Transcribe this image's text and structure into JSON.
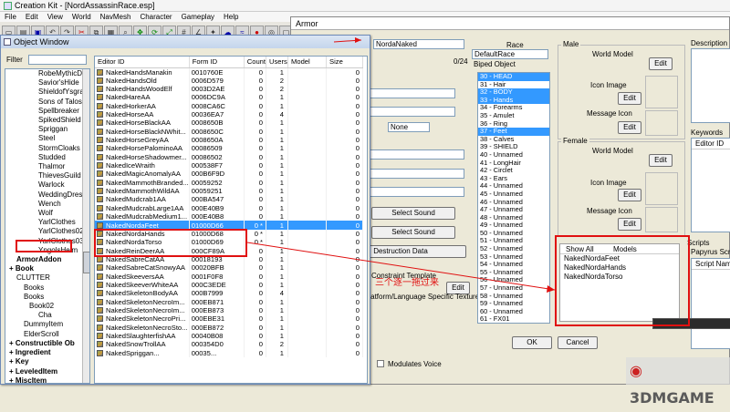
{
  "app": {
    "title": "Creation Kit - [NordAssassinRace.esp]",
    "menu": [
      "File",
      "Edit",
      "View",
      "World",
      "NavMesh",
      "Character",
      "Gameplay",
      "Help"
    ],
    "toolbar_icons": [
      "new-icon",
      "open-icon",
      "save-icon",
      "undo-icon",
      "redo-icon",
      "cut-icon",
      "copy-icon",
      "paste-icon",
      "zoom-icon",
      "move-icon",
      "rotate-icon",
      "scale-icon",
      "snap-grid-icon",
      "snap-angle-icon",
      "light-icon",
      "sky-icon",
      "water-icon",
      "havok-icon",
      "camera-icon",
      "cell-icon",
      "marker-icon",
      "navmesh-icon",
      "render-icon",
      "wire-icon",
      "terrain-icon",
      "tree-icon",
      "grass-icon",
      "sound-icon",
      "script-icon",
      "quest-icon",
      "dialog-icon",
      "npc-icon",
      "package-icon",
      "combat-icon",
      "faction-icon",
      "race-icon",
      "class-icon",
      "spell-icon",
      "leveled-icon",
      "export-icon",
      "help-icon"
    ]
  },
  "armor": {
    "title": "Armor",
    "editor_id_value": "NordaNaked",
    "counter": "0/24",
    "race_label": "Race",
    "race_value": "DefaultRace",
    "biped_label": "Biped Object",
    "biped_items": [
      {
        "text": "30 - HEAD",
        "selected": true
      },
      {
        "text": "31 - Hair",
        "selected": false
      },
      {
        "text": "32 - BODY",
        "selected": true
      },
      {
        "text": "33 - Hands",
        "selected": true
      },
      {
        "text": "34 - Forearms",
        "selected": false
      },
      {
        "text": "35 - Amulet",
        "selected": false
      },
      {
        "text": "36 - Ring",
        "selected": false
      },
      {
        "text": "37 - Feet",
        "selected": true
      },
      {
        "text": "38 - Calves",
        "selected": false
      },
      {
        "text": "39 - SHIELD",
        "selected": false
      },
      {
        "text": "40 - Unnamed",
        "selected": false
      },
      {
        "text": "41 - LongHair",
        "selected": false
      },
      {
        "text": "42 - Circlet",
        "selected": false
      },
      {
        "text": "43 - Ears",
        "selected": false
      },
      {
        "text": "44 - Unnamed",
        "selected": false
      },
      {
        "text": "45 - Unnamed",
        "selected": false
      },
      {
        "text": "46 - Unnamed",
        "selected": false
      },
      {
        "text": "47 - Unnamed",
        "selected": false
      },
      {
        "text": "48 - Unnamed",
        "selected": false
      },
      {
        "text": "49 - Unnamed",
        "selected": false
      },
      {
        "text": "50 - Unnamed",
        "selected": false
      },
      {
        "text": "51 - Unnamed",
        "selected": false
      },
      {
        "text": "52 - Unnamed",
        "selected": false
      },
      {
        "text": "53 - Unnamed",
        "selected": false
      },
      {
        "text": "54 - Unnamed",
        "selected": false
      },
      {
        "text": "55 - Unnamed",
        "selected": false
      },
      {
        "text": "56 - Unnamed",
        "selected": false
      },
      {
        "text": "57 - Unnamed",
        "selected": false
      },
      {
        "text": "58 - Unnamed",
        "selected": false
      },
      {
        "text": "59 - Unnamed",
        "selected": false
      },
      {
        "text": "60 - Unnamed",
        "selected": false
      },
      {
        "text": "61 - FX01",
        "selected": false
      }
    ],
    "none_option": "None",
    "select_sound_1": "Select Sound",
    "select_sound_2": "Select Sound",
    "destruction_data": "Destruction Data",
    "constraint_template": "Constraint Template",
    "edit": "Edit",
    "platform_textures": "Platform/Language Specific Textures",
    "modulates_voice": "Modulates Voice",
    "male_label": "Male",
    "female_label": "Female",
    "world_model": "World Model",
    "icon_image": "Icon Image",
    "message_icon": "Message Icon",
    "show_all": "Show All",
    "models_header": "Models",
    "models": [
      "NakedNordaFeet",
      "NakedNordaHands",
      "NakedNordaTorso"
    ],
    "ok": "OK",
    "cancel": "Cancel",
    "description_label": "Description",
    "keywords_label": "Keywords",
    "keywords_col": "Editor ID",
    "scripts_label": "Scripts",
    "papyrus_label": "Papyrus Scripts:",
    "script_name_col": "Script Nam",
    "annotation": "三个逐一拖过来"
  },
  "object_window": {
    "title": "Object Window",
    "filter_label": "Filter",
    "filter_value": "",
    "tree": [
      {
        "text": "RobeMythicDa",
        "level": 4,
        "bold": false
      },
      {
        "text": "Savior'sHide",
        "level": 4,
        "bold": false
      },
      {
        "text": "ShieldofYsgramo",
        "level": 4,
        "bold": false
      },
      {
        "text": "Sons of Talos",
        "level": 4,
        "bold": false
      },
      {
        "text": "Spellbreaker",
        "level": 4,
        "bold": false
      },
      {
        "text": "SpikedShield",
        "level": 4,
        "bold": false
      },
      {
        "text": "Spriggan",
        "level": 4,
        "bold": false
      },
      {
        "text": "Steel",
        "level": 4,
        "bold": false
      },
      {
        "text": "StormCloaks",
        "level": 4,
        "bold": false
      },
      {
        "text": "Studded",
        "level": 4,
        "bold": false
      },
      {
        "text": "Thalmor",
        "level": 4,
        "bold": false
      },
      {
        "text": "ThievesGuild",
        "level": 4,
        "bold": false
      },
      {
        "text": "Warlock",
        "level": 4,
        "bold": false
      },
      {
        "text": "WeddingDress",
        "level": 4,
        "bold": false
      },
      {
        "text": "Wench",
        "level": 4,
        "bold": false
      },
      {
        "text": "Wolf",
        "level": 4,
        "bold": false
      },
      {
        "text": "YarlClothes",
        "level": 4,
        "bold": false
      },
      {
        "text": "YarlClothes02",
        "level": 4,
        "bold": false
      },
      {
        "text": "YarlClothes03",
        "level": 4,
        "bold": false
      },
      {
        "text": "YngolsHelm",
        "level": 4,
        "bold": false
      },
      {
        "text": "ArmorAddon",
        "level": 1,
        "bold": true
      },
      {
        "text": "Book",
        "level": 0,
        "bold": true
      },
      {
        "text": "CLUTTER",
        "level": 1,
        "bold": false
      },
      {
        "text": "Books",
        "level": 2,
        "bold": false
      },
      {
        "text": "Books",
        "level": 2,
        "bold": false
      },
      {
        "text": "Book02",
        "level": 3,
        "bold": false
      },
      {
        "text": "Cha",
        "level": 4,
        "bold": false
      },
      {
        "text": "DummyItem",
        "level": 2,
        "bold": false
      },
      {
        "text": "ElderScroll",
        "level": 2,
        "bold": false
      },
      {
        "text": "Constructible Ob",
        "level": 0,
        "bold": true
      },
      {
        "text": "Ingredient",
        "level": 0,
        "bold": true
      },
      {
        "text": "Key",
        "level": 0,
        "bold": true
      },
      {
        "text": "LeveledItem",
        "level": 0,
        "bold": true
      },
      {
        "text": "MiscItem",
        "level": 0,
        "bold": true
      }
    ],
    "columns": [
      "Editor ID",
      "Form ID",
      "Count",
      "Users",
      "Model",
      "Size"
    ],
    "rows": [
      {
        "id": "NakedHandsManakin",
        "form": "0010760E",
        "count": "0",
        "users": "1",
        "model": "",
        "size": "0",
        "sel": false
      },
      {
        "id": "NakedHandsOld",
        "form": "0006D579",
        "count": "0",
        "users": "2",
        "model": "",
        "size": "0",
        "sel": false
      },
      {
        "id": "NakedHandsWoodElf",
        "form": "0003D2AE",
        "count": "0",
        "users": "2",
        "model": "",
        "size": "0",
        "sel": false
      },
      {
        "id": "NakedHareAA",
        "form": "0006DC9A",
        "count": "0",
        "users": "1",
        "model": "",
        "size": "0",
        "sel": false
      },
      {
        "id": "NakedHorkerAA",
        "form": "0008CA6C",
        "count": "0",
        "users": "1",
        "model": "",
        "size": "0",
        "sel": false
      },
      {
        "id": "NakedHorseAA",
        "form": "00036EA7",
        "count": "0",
        "users": "4",
        "model": "",
        "size": "0",
        "sel": false
      },
      {
        "id": "NakedHorseBlackAA",
        "form": "0008650B",
        "count": "0",
        "users": "1",
        "model": "",
        "size": "0",
        "sel": false
      },
      {
        "id": "NakedHorseBlackNWhit...",
        "form": "0008650C",
        "count": "0",
        "users": "1",
        "model": "",
        "size": "0",
        "sel": false
      },
      {
        "id": "NakedHorseGreyAA",
        "form": "0008650A",
        "count": "0",
        "users": "1",
        "model": "",
        "size": "0",
        "sel": false
      },
      {
        "id": "NakedHorsePalominoAA",
        "form": "00086509",
        "count": "0",
        "users": "1",
        "model": "",
        "size": "0",
        "sel": false
      },
      {
        "id": "NakedHorseShadowmer...",
        "form": "00086502",
        "count": "0",
        "users": "1",
        "model": "",
        "size": "0",
        "sel": false
      },
      {
        "id": "NakedIceWraith",
        "form": "000538F7",
        "count": "0",
        "users": "1",
        "model": "",
        "size": "0",
        "sel": false
      },
      {
        "id": "NakedMagicAnomalyAA",
        "form": "000B6F9D",
        "count": "0",
        "users": "1",
        "model": "",
        "size": "0",
        "sel": false
      },
      {
        "id": "NakedMammothBranded...",
        "form": "00059252",
        "count": "0",
        "users": "1",
        "model": "",
        "size": "0",
        "sel": false
      },
      {
        "id": "NakedMammothWildAA",
        "form": "00059251",
        "count": "0",
        "users": "1",
        "model": "",
        "size": "0",
        "sel": false
      },
      {
        "id": "NakedMudcrab1AA",
        "form": "000BA547",
        "count": "0",
        "users": "1",
        "model": "",
        "size": "0",
        "sel": false
      },
      {
        "id": "NakedMudcrabLarge1AA",
        "form": "000E40B9",
        "count": "0",
        "users": "1",
        "model": "",
        "size": "0",
        "sel": false
      },
      {
        "id": "NakedMudcrabMedium1...",
        "form": "000E40B8",
        "count": "0",
        "users": "1",
        "model": "",
        "size": "0",
        "sel": false
      },
      {
        "id": "NakedNordaFeet",
        "form": "01000D66",
        "count": "0 *",
        "users": "1",
        "model": "",
        "size": "0",
        "sel": true
      },
      {
        "id": "NakedNordaHands",
        "form": "01000D68",
        "count": "0 *",
        "users": "1",
        "model": "",
        "size": "0",
        "sel": false
      },
      {
        "id": "NakedNordaTorso",
        "form": "01000D69",
        "count": "0 *",
        "users": "1",
        "model": "",
        "size": "0",
        "sel": false
      },
      {
        "id": "NakedReinDeerAA",
        "form": "000CF89A",
        "count": "0",
        "users": "1",
        "model": "",
        "size": "0",
        "sel": false
      },
      {
        "id": "NakedSabreCatAA",
        "form": "00018193",
        "count": "0",
        "users": "1",
        "model": "",
        "size": "0",
        "sel": false
      },
      {
        "id": "NakedSabreCatSnowyAA",
        "form": "00020BFB",
        "count": "0",
        "users": "1",
        "model": "",
        "size": "0",
        "sel": false
      },
      {
        "id": "NakedSkeeversAA",
        "form": "0001F0F8",
        "count": "0",
        "users": "1",
        "model": "",
        "size": "0",
        "sel": false
      },
      {
        "id": "NakedSkeeverWhiteAA",
        "form": "000C3EDE",
        "count": "0",
        "users": "1",
        "model": "",
        "size": "0",
        "sel": false
      },
      {
        "id": "NakedSkeletonBodyAA",
        "form": "000B7999",
        "count": "0",
        "users": "4",
        "model": "",
        "size": "0",
        "sel": false
      },
      {
        "id": "NakedSkeletonNecroIm...",
        "form": "000EB871",
        "count": "0",
        "users": "1",
        "model": "",
        "size": "0",
        "sel": false
      },
      {
        "id": "NakedSkeletonNecroIm...",
        "form": "000EB873",
        "count": "0",
        "users": "1",
        "model": "",
        "size": "0",
        "sel": false
      },
      {
        "id": "NakedSkeletonNecroPri...",
        "form": "000EBE31",
        "count": "0",
        "users": "1",
        "model": "",
        "size": "0",
        "sel": false
      },
      {
        "id": "NakedSkeletonNecroSto...",
        "form": "000EB872",
        "count": "0",
        "users": "1",
        "model": "",
        "size": "0",
        "sel": false
      },
      {
        "id": "NakedSlaughterfishAA",
        "form": "00040B08",
        "count": "0",
        "users": "1",
        "model": "",
        "size": "0",
        "sel": false
      },
      {
        "id": "NakedSnowTrollAA",
        "form": "000354D0",
        "count": "0",
        "users": "2",
        "model": "",
        "size": "0",
        "sel": false
      },
      {
        "id": "NakedSpriggan...",
        "form": "00035...",
        "count": "0",
        "users": "1",
        "model": "",
        "size": "0",
        "sel": false
      }
    ]
  },
  "watermark": "3DMGAME"
}
